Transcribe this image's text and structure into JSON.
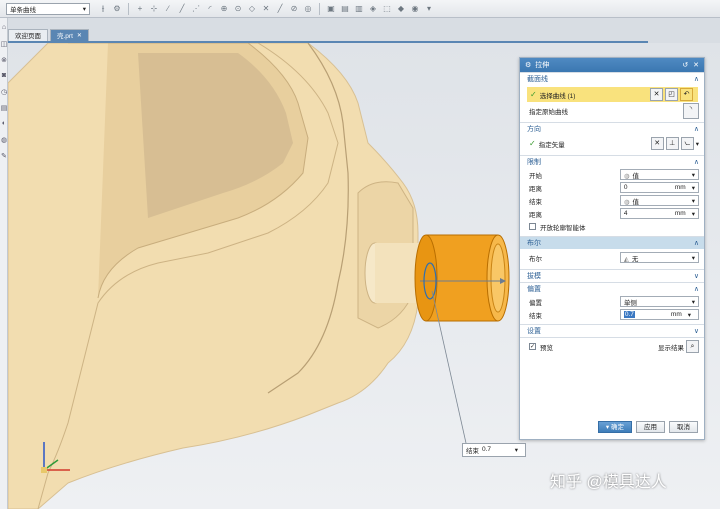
{
  "toolbar": {
    "filter_value": "单条曲线",
    "icons": [
      "curve-rule-icon",
      "snap-icon",
      "point-icon",
      "line-icon",
      "arc-icon",
      "view-icons"
    ]
  },
  "tabs": [
    {
      "label": "欢迎页面",
      "active": false
    },
    {
      "label": "壳.prt",
      "active": true,
      "close": "✕"
    }
  ],
  "dialog": {
    "title": "拉伸",
    "sections": {
      "section_curve": {
        "header": "截面线",
        "select_curve": "选择曲线 (1)",
        "specify_origin": "指定原始曲线"
      },
      "direction": {
        "header": "方向",
        "specify_vector": "指定矢量"
      },
      "limits": {
        "header": "限制",
        "start_label": "开始",
        "start_value": "值",
        "start_dist_label": "距离",
        "start_dist": "0",
        "end_label": "结束",
        "end_value": "值",
        "end_dist_label": "距离",
        "end_dist": "4",
        "unit": "mm",
        "open_profile": "开放轮廓智能体"
      },
      "boolean": {
        "header": "布尔",
        "label": "布尔",
        "value": "无"
      },
      "draft": {
        "header": "拔模"
      },
      "offset": {
        "header": "偏置",
        "offset_label": "偏置",
        "offset_value": "单侧",
        "end_label": "结束",
        "end_value": "0.7",
        "unit": "mm"
      },
      "settings": {
        "header": "设置"
      }
    },
    "preview_label": "预览",
    "show_result": "显示结果",
    "ok": "确定",
    "apply": "应用",
    "cancel": "取消"
  },
  "on_graphic": {
    "label": "结束",
    "value": "0.7"
  },
  "watermark": "知乎 @模具达人",
  "colors": {
    "part": "#f2ddb0",
    "cylinder": "#f0a020",
    "title": "#3b77b1",
    "highlight": "#f9e27d"
  }
}
